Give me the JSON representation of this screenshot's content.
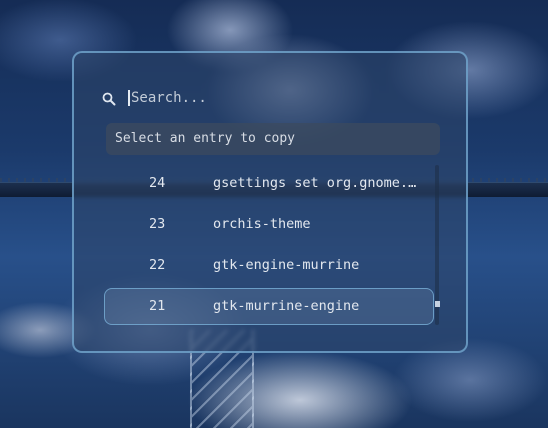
{
  "search": {
    "placeholder": "Search...",
    "icon": "search-icon"
  },
  "prompt": "Select an entry to copy",
  "entries": [
    {
      "index": "24",
      "text": "gsettings set org.gnome.…"
    },
    {
      "index": "23",
      "text": "orchis-theme"
    },
    {
      "index": "22",
      "text": "gtk-engine-murrine"
    },
    {
      "index": "21",
      "text": "gtk-murrine-engine",
      "selected": true
    }
  ],
  "colors": {
    "accent_border": "#78afd7",
    "text": "#e3e8ef"
  }
}
